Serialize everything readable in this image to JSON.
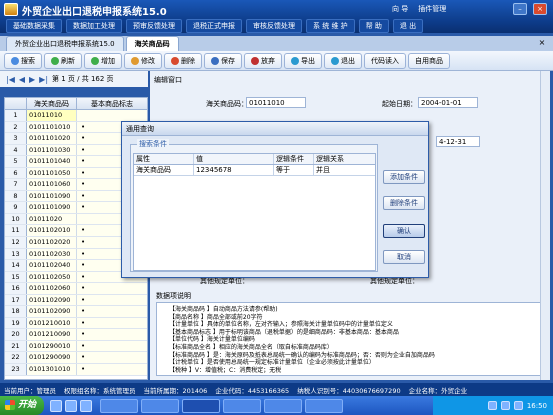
{
  "app": {
    "title": "外贸企业出口退税申报系统15.0"
  },
  "titlebar_links": [
    "向 导",
    "插件管理"
  ],
  "menus": [
    "基础数据采集",
    "数据加工处理",
    "预审反馈处理",
    "退税正式申报",
    "审核反馈处理",
    "系 统 维 护",
    "帮 助",
    "退 出"
  ],
  "tabs": [
    {
      "label": "外贸企业出口退税申报系统15.0"
    },
    {
      "label": "海关商品码"
    }
  ],
  "toolbar": [
    "搜索",
    "刷新",
    "增加",
    "修改",
    "删除",
    "保存",
    "放弃",
    "导出",
    "退出",
    "代码读入",
    "自用商品"
  ],
  "nav": {
    "page_text": "第 1 页 / 共 162 页"
  },
  "grid": {
    "headers": [
      "海关商品码",
      "基本商品标志"
    ],
    "rows": [
      {
        "n": "1",
        "code": "01011010",
        "flag": ""
      },
      {
        "n": "2",
        "code": "0101101010",
        "flag": "•"
      },
      {
        "n": "3",
        "code": "0101101020",
        "flag": "•"
      },
      {
        "n": "4",
        "code": "0101101030",
        "flag": "•"
      },
      {
        "n": "5",
        "code": "0101101040",
        "flag": "•"
      },
      {
        "n": "6",
        "code": "0101101050",
        "flag": "•"
      },
      {
        "n": "7",
        "code": "0101101060",
        "flag": "•"
      },
      {
        "n": "8",
        "code": "0101101090",
        "flag": "•"
      },
      {
        "n": "9",
        "code": "0101101090",
        "flag": "•"
      },
      {
        "n": "10",
        "code": "01011020",
        "flag": ""
      },
      {
        "n": "11",
        "code": "0101102010",
        "flag": "•"
      },
      {
        "n": "12",
        "code": "0101102020",
        "flag": "•"
      },
      {
        "n": "13",
        "code": "0101102030",
        "flag": "•"
      },
      {
        "n": "14",
        "code": "0101102040",
        "flag": "•"
      },
      {
        "n": "15",
        "code": "0101102050",
        "flag": "•"
      },
      {
        "n": "16",
        "code": "0101102060",
        "flag": "•"
      },
      {
        "n": "17",
        "code": "0101102090",
        "flag": "•"
      },
      {
        "n": "18",
        "code": "0101102090",
        "flag": "•"
      },
      {
        "n": "19",
        "code": "0101210010",
        "flag": "•"
      },
      {
        "n": "20",
        "code": "0101210090",
        "flag": "•"
      },
      {
        "n": "21",
        "code": "0101290010",
        "flag": "•"
      },
      {
        "n": "22",
        "code": "0101290090",
        "flag": "•"
      },
      {
        "n": "23",
        "code": "0101301010",
        "flag": "•"
      }
    ]
  },
  "editor": {
    "title": "编辑窗口",
    "code_label": "海关商品码：",
    "code_value": "01011010",
    "start_label": "起始日期：",
    "start_value": "2004-01-01",
    "end_value": "4-12-31",
    "other_label1": "其他规定单位：",
    "other_label2": "其他规定单位："
  },
  "description": {
    "title": "数据项说明",
    "lines": [
      "【海关商品码    】自动商品方法请参(帮助)",
      "【商品名称      】商品全部或前20字符",
      "【计量单位      】具体的单位名称，左对齐输入；参照海关计量单位码中的计量单位定义",
      "【基本商品标志  】用于标明该商品（退税单据）的是细商品码：非基本商品：基本商品",
      "【单位代码      】海关计量单位编码",
      "【标准商品全名  】相应的海关商品全名（取自标准商品码库）",
      "【标准商品码    】是：海关原码及抵表总局统一确认的编码为标准商品码；否：否则为企业自加商品码",
      "【计税单位      】是否使用总局统一规定标准计量单位（企业必须按此计量单位）",
      "【税种          】V：增值税；C：消费税定；无税"
    ]
  },
  "dialog": {
    "title": "通用查询",
    "group_label": "搜索条件",
    "headers": [
      "属性",
      "值",
      "逻辑条件",
      "逻辑关系"
    ],
    "row": {
      "attr": "海关商品码",
      "value": "12345678",
      "cond": "等于",
      "rel": "并且"
    },
    "buttons": [
      "添加条件",
      "删除条件",
      "确认",
      "取消"
    ]
  },
  "status": {
    "user": "当前用户：管理员",
    "role": "权限组名称：系统管理员",
    "period": "当前所属期：201406",
    "code": "企业代码：4453166365",
    "taxid": "纳税人识别号：44030676697290",
    "name": "企业名称：外贸企业"
  },
  "taskbar": {
    "start": "开始",
    "clock": "16:50"
  }
}
